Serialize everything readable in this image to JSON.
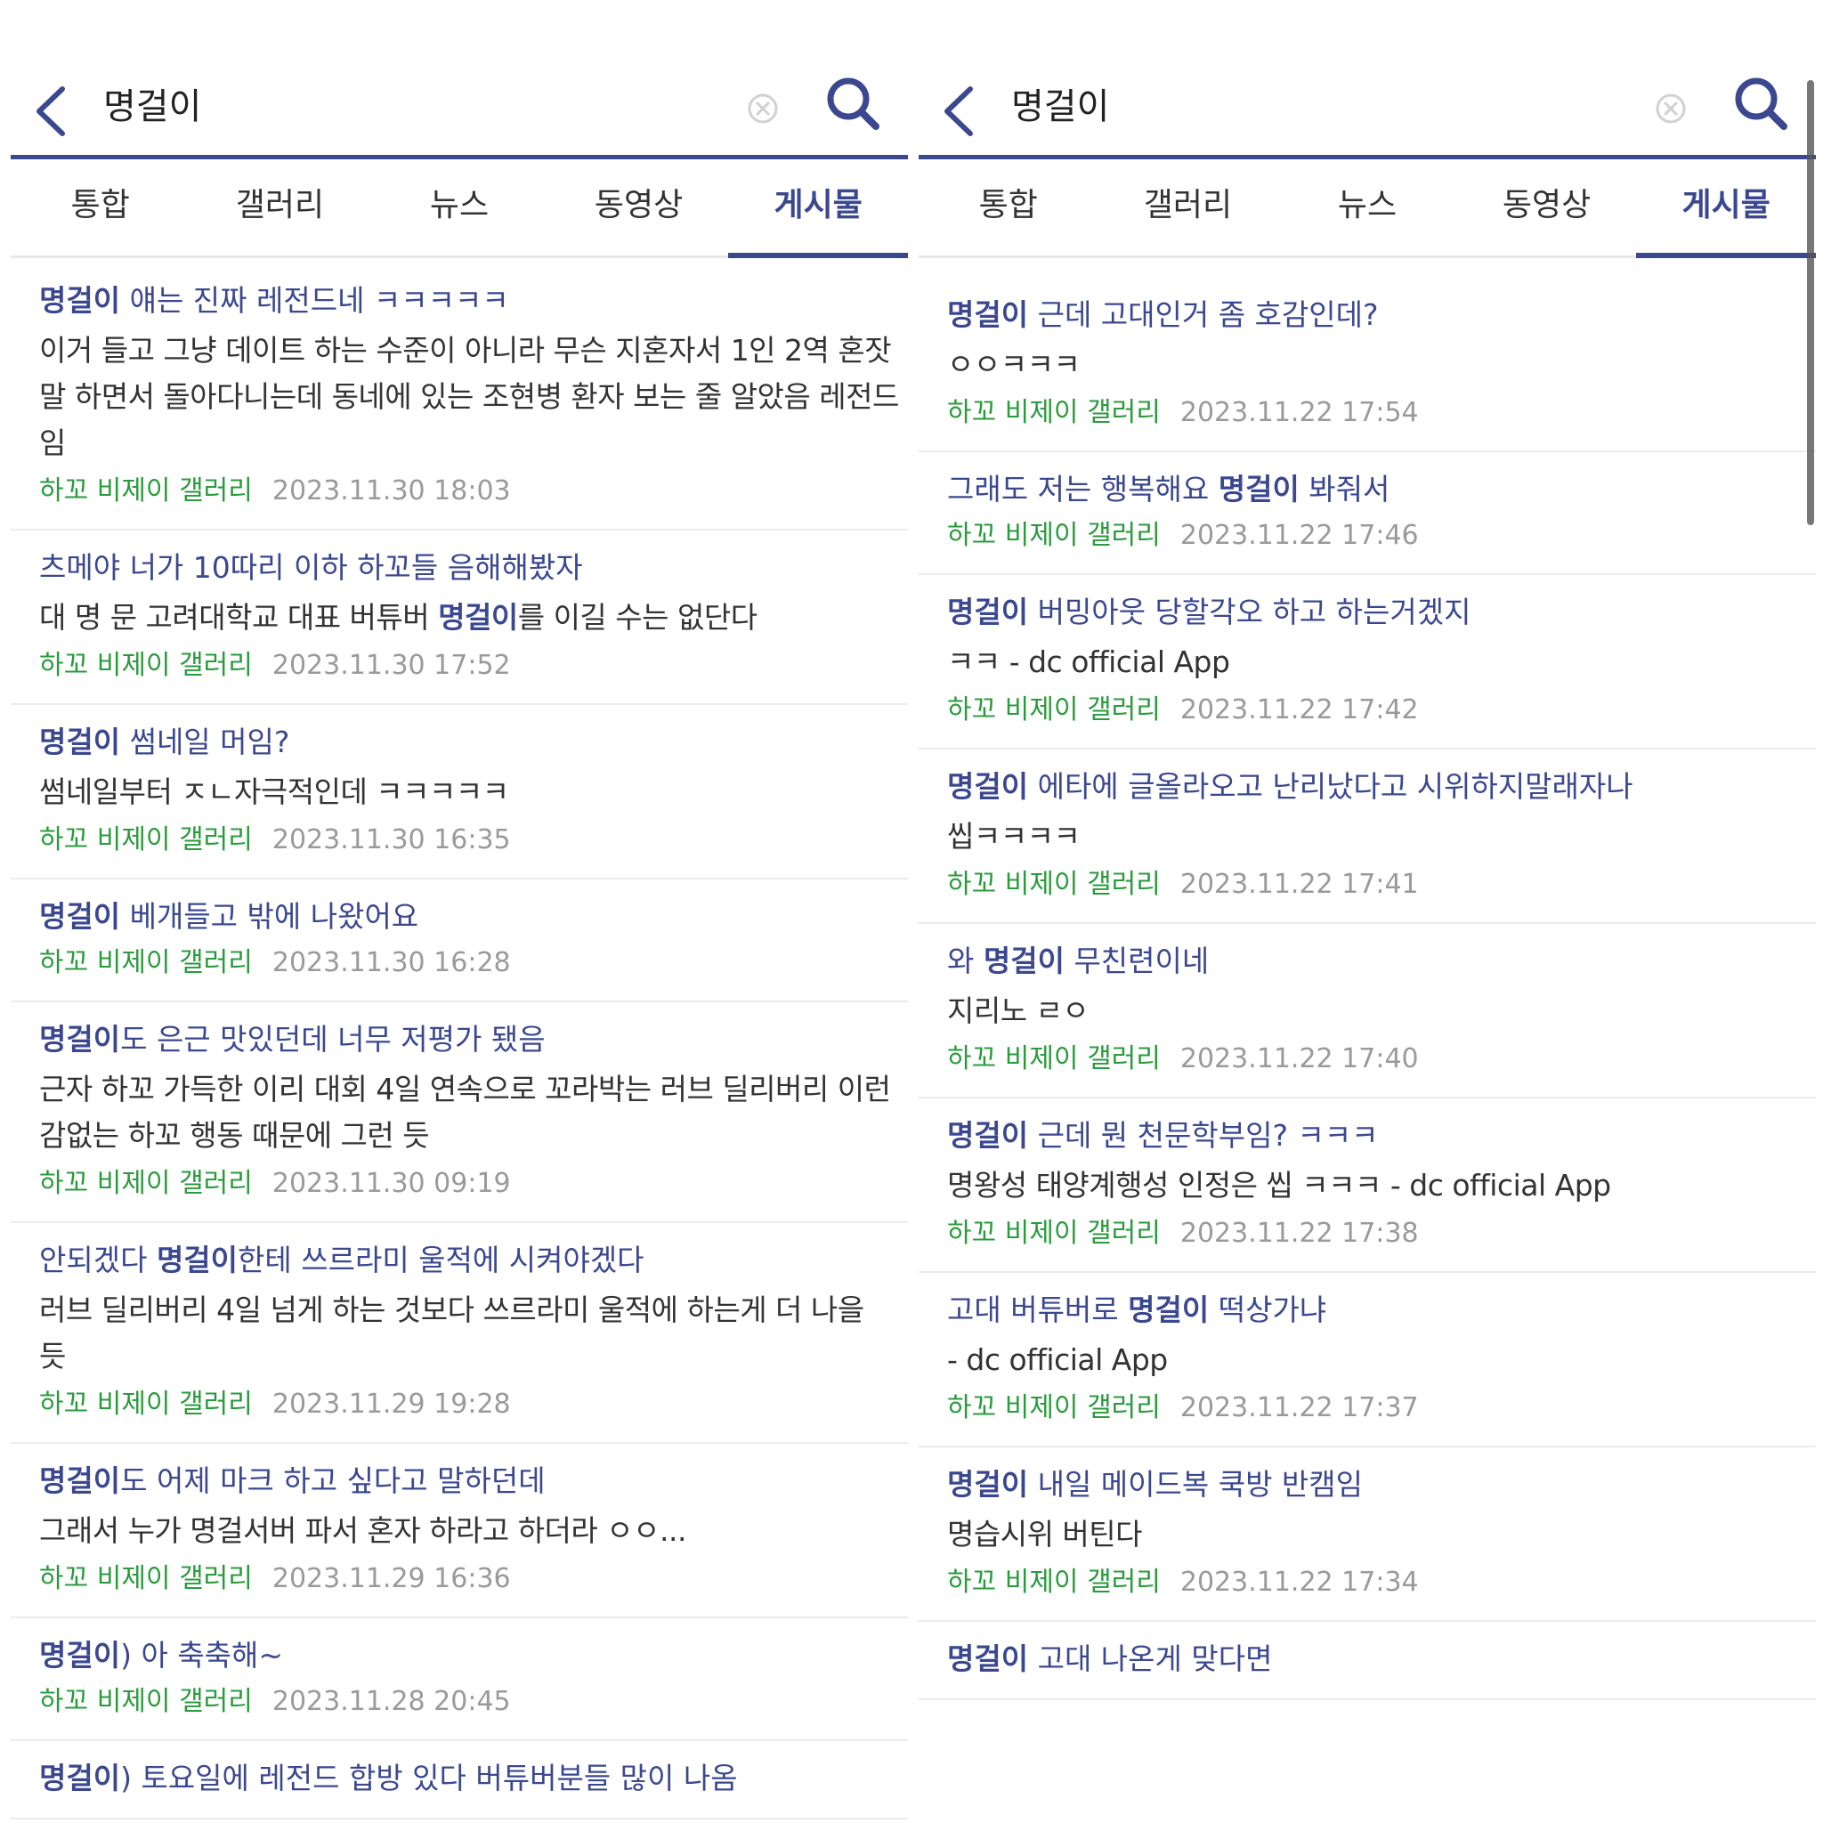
{
  "left": {
    "search": {
      "query": "명걸이"
    },
    "tabs": [
      {
        "label": "통합",
        "active": false
      },
      {
        "label": "갤러리",
        "active": false
      },
      {
        "label": "뉴스",
        "active": false
      },
      {
        "label": "동영상",
        "active": false
      },
      {
        "label": "게시물",
        "active": true
      }
    ],
    "results": [
      {
        "title": [
          {
            "t": "명걸이",
            "hl": true
          },
          {
            "t": " 얘는 진짜 레전드네 ㅋㅋㅋㅋㅋ",
            "hl": false
          }
        ],
        "body": [
          {
            "t": "이거 들고 그냥 데이트 하는 수준이 아니라 무슨 지혼자서 1인 2역 혼잣말 하면서 돌아다니는데 동네에 있는 조현병 환자 보는 줄 알았음 레전드임",
            "hl": false
          }
        ],
        "gallery": "하꼬 비제이 갤러리",
        "date": "2023.11.30 18:03"
      },
      {
        "title": [
          {
            "t": "츠메야 너가 10따리 이하 하꼬들 음해해봤자",
            "hl": false
          }
        ],
        "body": [
          {
            "t": "대 명 문 고려대학교 대표 버튜버 ",
            "hl": false
          },
          {
            "t": "명걸이",
            "hl": true
          },
          {
            "t": "를 이길 수는 없단다",
            "hl": false
          }
        ],
        "gallery": "하꼬 비제이 갤러리",
        "date": "2023.11.30 17:52"
      },
      {
        "title": [
          {
            "t": "명걸이",
            "hl": true
          },
          {
            "t": " 썸네일 머임?",
            "hl": false
          }
        ],
        "body": [
          {
            "t": "썸네일부터 ㅈㄴ자극적인데 ㅋㅋㅋㅋㅋ",
            "hl": false
          }
        ],
        "gallery": "하꼬 비제이 갤러리",
        "date": "2023.11.30 16:35"
      },
      {
        "title": [
          {
            "t": "명걸이",
            "hl": true
          },
          {
            "t": " 베개들고 밖에 나왔어요",
            "hl": false
          }
        ],
        "body": [],
        "gallery": "하꼬 비제이 갤러리",
        "date": "2023.11.30 16:28"
      },
      {
        "title": [
          {
            "t": "명걸이",
            "hl": true
          },
          {
            "t": "도 은근 맛있던데 너무 저평가 됐음",
            "hl": false
          }
        ],
        "body": [
          {
            "t": "근자 하꼬 가득한 이리 대회 4일 연속으로 꼬라박는 러브 딜리버리 이런 감없는 하꼬 행동 때문에 그런 듯",
            "hl": false
          }
        ],
        "gallery": "하꼬 비제이 갤러리",
        "date": "2023.11.30 09:19"
      },
      {
        "title": [
          {
            "t": "안되겠다 ",
            "hl": false
          },
          {
            "t": "명걸이",
            "hl": true
          },
          {
            "t": "한테 쓰르라미 울적에 시켜야겠다",
            "hl": false
          }
        ],
        "body": [
          {
            "t": "러브 딜리버리 4일 넘게 하는 것보다 쓰르라미 울적에 하는게 더 나을 듯",
            "hl": false
          }
        ],
        "gallery": "하꼬 비제이 갤러리",
        "date": "2023.11.29 19:28"
      },
      {
        "title": [
          {
            "t": "명걸이",
            "hl": true
          },
          {
            "t": "도 어제 마크 하고 싶다고 말하던데",
            "hl": false
          }
        ],
        "body": [
          {
            "t": "그래서 누가 명걸서버 파서 혼자 하라고 하더라 ㅇㅇ...",
            "hl": false
          }
        ],
        "gallery": "하꼬 비제이 갤러리",
        "date": "2023.11.29 16:36"
      },
      {
        "title": [
          {
            "t": "명걸이",
            "hl": true
          },
          {
            "t": ") 아 축축해~",
            "hl": false
          }
        ],
        "body": [],
        "gallery": "하꼬 비제이 갤러리",
        "date": "2023.11.28 20:45"
      },
      {
        "title": [
          {
            "t": "명걸이",
            "hl": true
          },
          {
            "t": ") 토요일에 레전드 합방 있다 버튜버분들 많이 나옴",
            "hl": false
          }
        ],
        "body": [],
        "gallery": "",
        "date": ""
      }
    ]
  },
  "right": {
    "search": {
      "query": "명걸이"
    },
    "tabs": [
      {
        "label": "통합",
        "active": false
      },
      {
        "label": "갤러리",
        "active": false
      },
      {
        "label": "뉴스",
        "active": false
      },
      {
        "label": "동영상",
        "active": false
      },
      {
        "label": "게시물",
        "active": true
      }
    ],
    "results": [
      {
        "title": [
          {
            "t": "명걸이",
            "hl": true
          },
          {
            "t": " 근데 고대인거 좀 호감인데?",
            "hl": false
          }
        ],
        "body": [
          {
            "t": "ㅇㅇㅋㅋㅋ",
            "hl": false
          }
        ],
        "gallery": "하꼬 비제이 갤러리",
        "date": "2023.11.22 17:54"
      },
      {
        "title": [
          {
            "t": "그래도 저는 행복해요 ",
            "hl": false
          },
          {
            "t": "명걸이",
            "hl": true
          },
          {
            "t": " 봐줘서",
            "hl": false
          }
        ],
        "body": [],
        "gallery": "하꼬 비제이 갤러리",
        "date": "2023.11.22 17:46"
      },
      {
        "title": [
          {
            "t": "명걸이",
            "hl": true
          },
          {
            "t": " 버밍아웃 당할각오 하고 하는거겠지",
            "hl": false
          }
        ],
        "body": [
          {
            "t": "ㅋㅋ - dc official App",
            "hl": false
          }
        ],
        "gallery": "하꼬 비제이 갤러리",
        "date": "2023.11.22 17:42"
      },
      {
        "title": [
          {
            "t": "명걸이",
            "hl": true
          },
          {
            "t": " 에타에 글올라오고 난리났다고 시위하지말래자나",
            "hl": false
          }
        ],
        "body": [
          {
            "t": "씹ㅋㅋㅋㅋ",
            "hl": false
          }
        ],
        "gallery": "하꼬 비제이 갤러리",
        "date": "2023.11.22 17:41"
      },
      {
        "title": [
          {
            "t": "와 ",
            "hl": false
          },
          {
            "t": "명걸이",
            "hl": true
          },
          {
            "t": " 무친련이네",
            "hl": false
          }
        ],
        "body": [
          {
            "t": "지리노 ㄹㅇ",
            "hl": false
          }
        ],
        "gallery": "하꼬 비제이 갤러리",
        "date": "2023.11.22 17:40"
      },
      {
        "title": [
          {
            "t": "명걸이",
            "hl": true
          },
          {
            "t": " 근데 뭔 천문학부임? ㅋㅋㅋ",
            "hl": false
          }
        ],
        "body": [
          {
            "t": "명왕성 태양계행성 인정은 씹 ㅋㅋㅋ - dc official App",
            "hl": false
          }
        ],
        "gallery": "하꼬 비제이 갤러리",
        "date": "2023.11.22 17:38"
      },
      {
        "title": [
          {
            "t": "고대 버튜버로 ",
            "hl": false
          },
          {
            "t": "명걸이",
            "hl": true
          },
          {
            "t": " 떡상가냐",
            "hl": false
          }
        ],
        "body": [
          {
            "t": "- dc official App",
            "hl": false
          }
        ],
        "gallery": "하꼬 비제이 갤러리",
        "date": "2023.11.22 17:37"
      },
      {
        "title": [
          {
            "t": "명걸이",
            "hl": true
          },
          {
            "t": " 내일 메이드복 쿡방 반캠임",
            "hl": false
          }
        ],
        "body": [
          {
            "t": "명습시위 버틴다",
            "hl": false
          }
        ],
        "gallery": "하꼬 비제이 갤러리",
        "date": "2023.11.22 17:34"
      },
      {
        "title": [
          {
            "t": "명걸이",
            "hl": true
          },
          {
            "t": " 고대 나온게 맞다면",
            "hl": false
          }
        ],
        "body": [],
        "gallery": "",
        "date": ""
      }
    ]
  },
  "colors": {
    "accent": "#3b4890",
    "gallery": "#2a9b3c",
    "date": "#9a9a9a",
    "divider": "#ececf0"
  },
  "icons": {
    "back": "chevron-left-icon",
    "clear": "clear-circle-icon",
    "search": "magnifier-icon"
  }
}
